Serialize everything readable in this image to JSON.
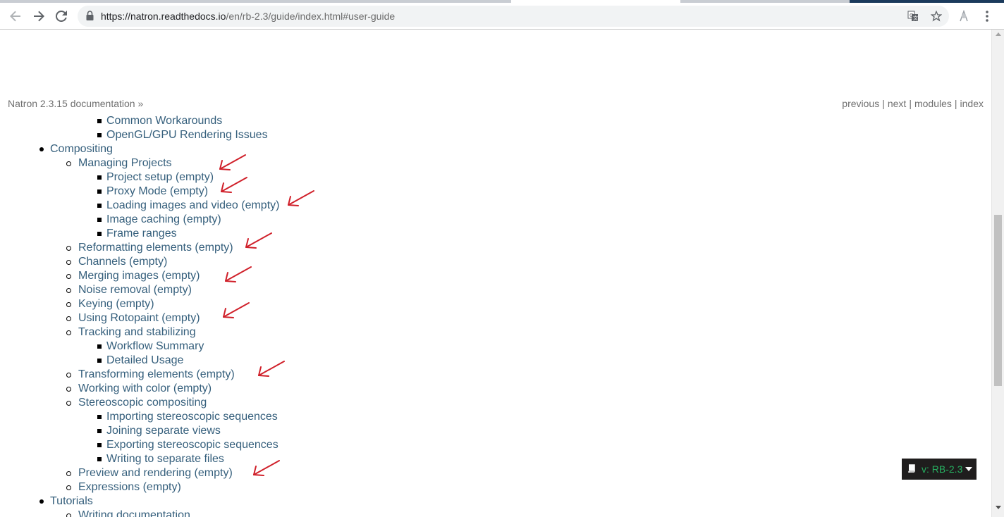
{
  "browser": {
    "url_host": "https://natron.readthedocs.io",
    "url_path": "/en/rb-2.3/guide/index.html#user-guide",
    "icons": [
      "back-icon",
      "forward-icon",
      "reload-icon",
      "lock-icon",
      "translate-icon",
      "star-icon",
      "extension-icon",
      "menu-icon"
    ]
  },
  "related": {
    "breadcrumb": "Natron 2.3.15 documentation »",
    "previous": "previous",
    "next": "next",
    "modules": "modules",
    "index": "index",
    "separator": "|"
  },
  "toc": [
    {
      "level": 3,
      "label": "Common Workarounds"
    },
    {
      "level": 3,
      "label": "OpenGL/GPU Rendering Issues"
    },
    {
      "level": 1,
      "label": "Compositing"
    },
    {
      "level": 2,
      "label": "Managing Projects"
    },
    {
      "level": 3,
      "label": "Project setup (empty)"
    },
    {
      "level": 3,
      "label": "Proxy Mode (empty)"
    },
    {
      "level": 3,
      "label": "Loading images and video (empty)"
    },
    {
      "level": 3,
      "label": "Image caching (empty)"
    },
    {
      "level": 3,
      "label": "Frame ranges"
    },
    {
      "level": 2,
      "label": "Reformatting elements (empty)"
    },
    {
      "level": 2,
      "label": "Channels (empty)"
    },
    {
      "level": 2,
      "label": "Merging images (empty)"
    },
    {
      "level": 2,
      "label": "Noise removal (empty)"
    },
    {
      "level": 2,
      "label": "Keying (empty)"
    },
    {
      "level": 2,
      "label": "Using Rotopaint (empty)"
    },
    {
      "level": 2,
      "label": "Tracking and stabilizing"
    },
    {
      "level": 3,
      "label": "Workflow Summary"
    },
    {
      "level": 3,
      "label": "Detailed Usage"
    },
    {
      "level": 2,
      "label": "Transforming elements (empty)"
    },
    {
      "level": 2,
      "label": "Working with color (empty)"
    },
    {
      "level": 2,
      "label": "Stereoscopic compositing"
    },
    {
      "level": 3,
      "label": "Importing stereoscopic sequences"
    },
    {
      "level": 3,
      "label": "Joining separate views"
    },
    {
      "level": 3,
      "label": "Exporting stereoscopic sequences"
    },
    {
      "level": 3,
      "label": "Writing to separate files"
    },
    {
      "level": 2,
      "label": "Preview and rendering (empty)"
    },
    {
      "level": 2,
      "label": "Expressions (empty)"
    },
    {
      "level": 1,
      "label": "Tutorials"
    },
    {
      "level": 2,
      "label": "Writing documentation"
    }
  ],
  "annotation_arrows": {
    "color": "#d0202a",
    "count": 8
  },
  "version_badge": {
    "label": "v: RB-2.3"
  },
  "colors": {
    "link": "#355f7c",
    "badge_bg": "#1f1d1d",
    "badge_text": "#27ae60"
  }
}
